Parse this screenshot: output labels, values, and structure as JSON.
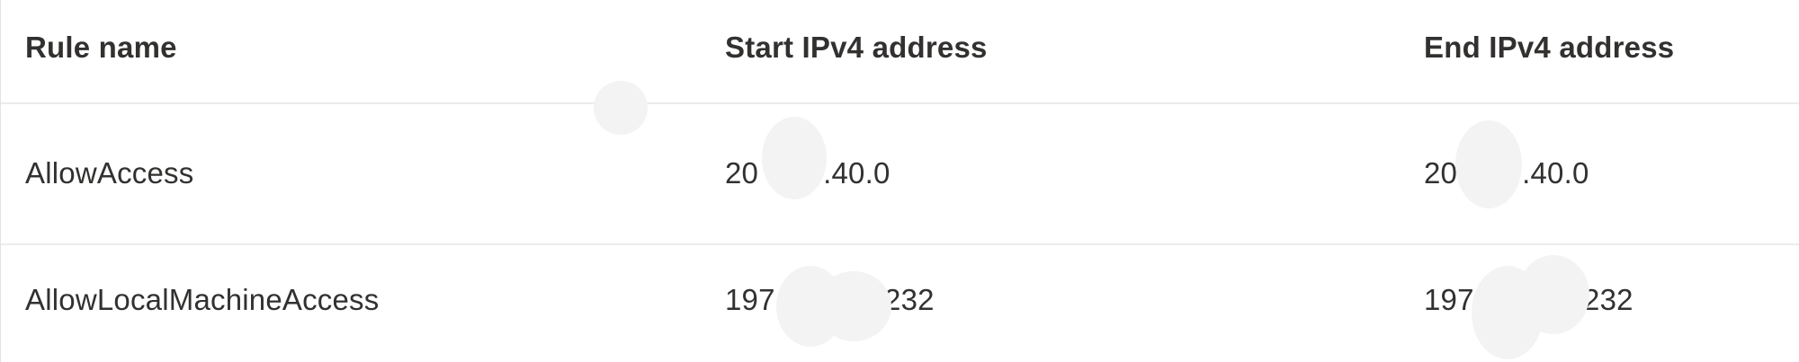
{
  "table": {
    "columns": {
      "rule_name": "Rule name",
      "start_ipv4": "Start IPv4 address",
      "end_ipv4": "End IPv4 address"
    },
    "rows": [
      {
        "rule_name": "AllowAccess",
        "start_prefix": "20",
        "start_suffix": ".40.0",
        "end_prefix": "20",
        "end_suffix": ".40.0"
      },
      {
        "rule_name": "AllowLocalMachineAccess",
        "start_prefix": "197",
        "start_suffix": ".232",
        "end_prefix": "197",
        "end_suffix": ".232"
      }
    ]
  },
  "colors": {
    "text": "#323130",
    "divider": "#ececec",
    "redaction": "#f3f3f3"
  }
}
